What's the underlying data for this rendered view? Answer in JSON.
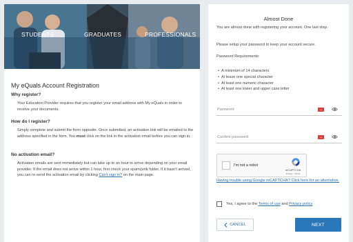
{
  "banner": {
    "tabs": [
      "STUDENTS",
      "GRADUATES",
      "PROFESSIONALS"
    ]
  },
  "info": {
    "title": "My eQuals Account Registration",
    "why_heading": "Why register?",
    "why_text": "Your Education Provider requires that you register your email address with My eQuals in order to receive your documents.",
    "how_heading": "How do I register?",
    "how_text_1": "Simply complete and submit the form opposite. Once submitted, an activation link will be emailed to the address specified in the form. You ",
    "how_text_must": "must",
    "how_text_2": " click on the link in the activation email before you can sign in.",
    "noact_heading": "No activation email?",
    "noact_text": "Activation emails are sent immediately but can take up to an hour to arrive depending on your email provider. If the email does not arrive within 1 hour, first check your spam/junk folder. If it hasn't arrived, you can re-send the activation email by clicking ",
    "noact_link": "Can't sign in?",
    "noact_text_end": " on the main page."
  },
  "form": {
    "title": "Almost Done",
    "intro": "You are almost done with registering your account. One last step.",
    "setup": "Please setup your password to keep your account secure.",
    "req_heading": "Password Requirements:",
    "requirements": [
      "A minimum of 14 characters",
      "At lease one special character",
      "At least one numeric character",
      "At least one lower and upper case letter"
    ],
    "password_placeholder": "Password",
    "confirm_placeholder": "Confirm password",
    "captcha": {
      "label": "I'm not a robot",
      "brand": "reCAPTCHA",
      "terms": "Privacy - Terms"
    },
    "trouble_link": "Having trouble using Google reCAPTCHA? Click here for an alternative.",
    "agree_prefix": "Yes, I agree to the ",
    "terms_link": "Terms of use",
    "agree_and": " and ",
    "privacy_link": "Privacy policy",
    "cancel_label": "CANCEL",
    "next_label": "NEXT"
  },
  "colors": {
    "accent": "#2a78b8",
    "link": "#2a6fb0",
    "password_manager_icon": "#e03c3c",
    "background": "#e9ecef"
  },
  "icons": {
    "field_key": "password-manager-icon",
    "field_eye": "eye-icon",
    "cancel": "chevron-left-icon",
    "captcha": "recaptcha-logo-icon"
  }
}
